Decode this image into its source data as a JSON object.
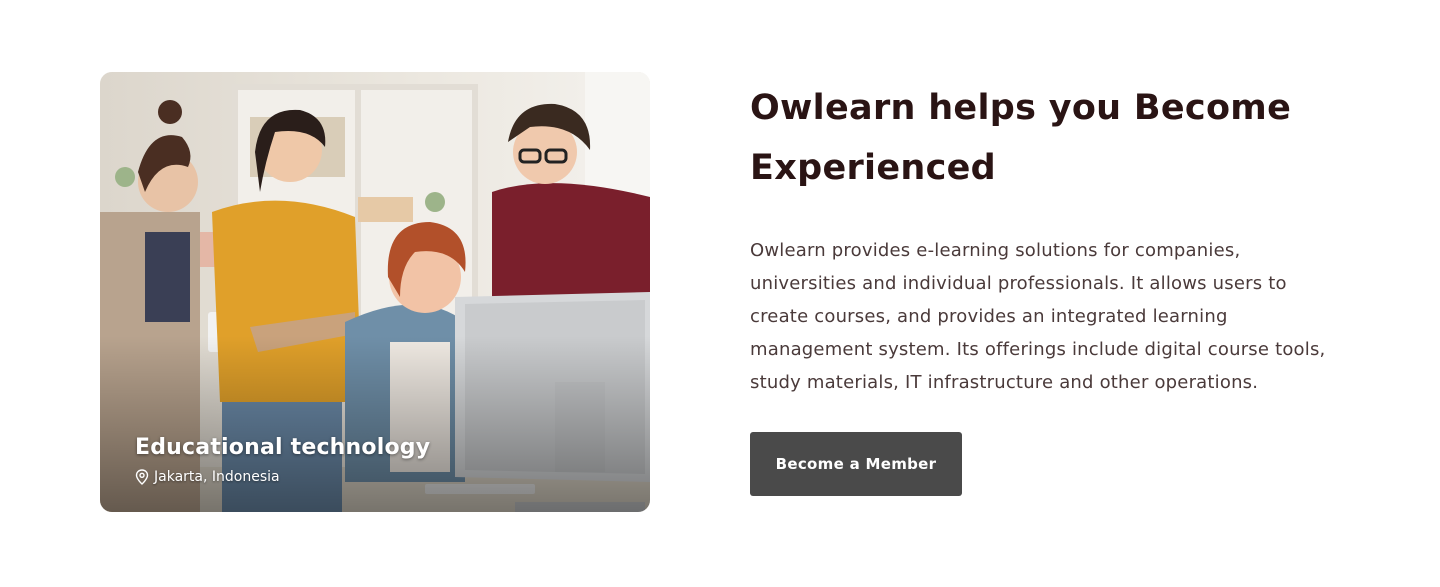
{
  "photo": {
    "caption_title": "Educational technology",
    "caption_location": "Jakarta, Indonesia",
    "location_icon": "map-pin-icon"
  },
  "content": {
    "headline": "Owlearn helps you Become Experienced",
    "description": "Owlearn provides e-learning solutions for companies, universities and individual professionals. It allows users to create courses, and provides an integrated learning management system. Its offerings include digital course tools, study materials, IT infrastructure and other operations.",
    "cta_label": "Become a Member"
  },
  "colors": {
    "headline": "#2a1414",
    "body_text": "#4a3a3a",
    "button_bg": "#4a4a4a",
    "button_text": "#ffffff"
  }
}
